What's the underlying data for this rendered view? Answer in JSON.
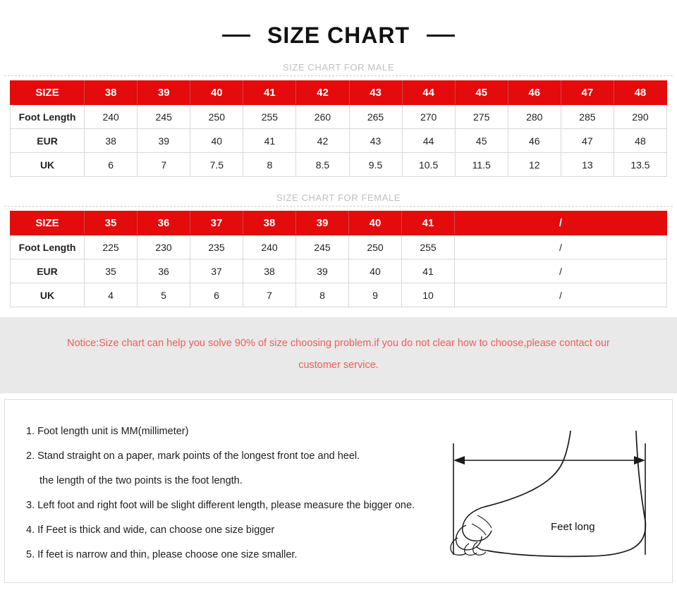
{
  "header": {
    "title": "SIZE CHART",
    "left_dash": "dash",
    "right_dash": "dash"
  },
  "male_section": {
    "label": "SIZE CHART FOR MALE",
    "row_labels": [
      "SIZE",
      "Foot Length",
      "EUR",
      "UK"
    ],
    "sizes": [
      "38",
      "39",
      "40",
      "41",
      "42",
      "43",
      "44",
      "45",
      "46",
      "47",
      "48"
    ],
    "foot_length": [
      "240",
      "245",
      "250",
      "255",
      "260",
      "265",
      "270",
      "275",
      "280",
      "285",
      "290"
    ],
    "eur": [
      "38",
      "39",
      "40",
      "41",
      "42",
      "43",
      "44",
      "45",
      "46",
      "47",
      "48"
    ],
    "uk": [
      "6",
      "7",
      "7.5",
      "8",
      "8.5",
      "9.5",
      "10.5",
      "11.5",
      "12",
      "13",
      "13.5"
    ]
  },
  "female_section": {
    "label": "SIZE CHART FOR FEMALE",
    "row_labels": [
      "SIZE",
      "Foot Length",
      "EUR",
      "UK"
    ],
    "sizes": [
      "35",
      "36",
      "37",
      "38",
      "39",
      "40",
      "41"
    ],
    "foot_length": [
      "225",
      "230",
      "235",
      "240",
      "245",
      "250",
      "255"
    ],
    "eur": [
      "35",
      "36",
      "37",
      "38",
      "39",
      "40",
      "41"
    ],
    "uk": [
      "4",
      "5",
      "6",
      "7",
      "8",
      "9",
      "10"
    ],
    "empty_value": "/"
  },
  "notice": {
    "line1": "Notice:Size chart can help you solve 90% of size choosing problem.if you do not clear how to choose,please contact our",
    "line2": "customer service."
  },
  "instructions": {
    "items": [
      "1. Foot length unit is MM(millimeter)",
      "2. Stand straight on a paper, mark points of the longest front toe and heel.",
      "the length of the two points is the foot length.",
      "3. Left foot and right foot will be slight different length, please measure the bigger one.",
      "4. If Feet is thick and wide, can choose one size bigger",
      "5. If feet is narrow and thin, please choose one size smaller."
    ]
  },
  "diagram": {
    "measure_label": "Feet long"
  },
  "colors": {
    "header_red": "#e30b0b",
    "notice_red": "#e8605a",
    "notice_band": "#e9e9e9",
    "sublabel_gray": "#bfbfbf",
    "border_gray": "#d8d8d8"
  }
}
